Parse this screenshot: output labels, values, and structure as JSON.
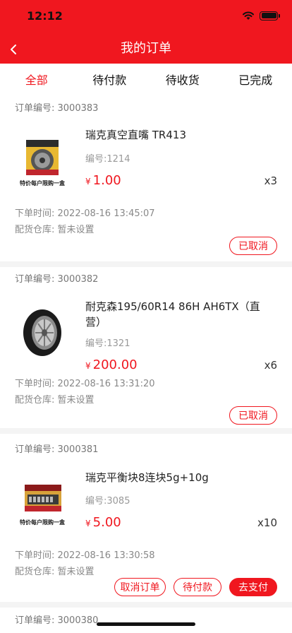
{
  "status_bar": {
    "time": "12:12"
  },
  "nav": {
    "title": "我的订单"
  },
  "tabs": [
    {
      "label": "全部",
      "active": true
    },
    {
      "label": "待付款",
      "active": false
    },
    {
      "label": "待收货",
      "active": false
    },
    {
      "label": "已完成",
      "active": false
    }
  ],
  "orders": [
    {
      "order_no": "订单编号: 3000383",
      "product_name": "瑞克真空直嘴 TR413",
      "product_code": "编号:1214",
      "image_caption": "特价每户限购一盒",
      "price_symbol": "¥",
      "price": "1.00",
      "quantity": "x3",
      "order_time": "下单时间: 2022-08-16 13:45:07",
      "warehouse": "配货仓库: 暂未设置",
      "buttons": [
        "已取消"
      ]
    },
    {
      "order_no": "订单编号: 3000382",
      "product_name": "耐克森195/60R14 86H AH6TX（直营）",
      "product_code": "编号:1321",
      "price_symbol": "¥",
      "price": "200.00",
      "quantity": "x6",
      "order_time": "下单时间: 2022-08-16 13:31:20",
      "warehouse": "配货仓库: 暂未设置",
      "buttons": [
        "已取消"
      ]
    },
    {
      "order_no": "订单编号: 3000381",
      "product_name": "瑞克平衡块8连块5g+10g",
      "product_code": "编号:3085",
      "image_caption": "特价每户限购一盒",
      "price_symbol": "¥",
      "price": "5.00",
      "quantity": "x10",
      "order_time": "下单时间: 2022-08-16 13:30:58",
      "warehouse": "配货仓库: 暂未设置",
      "buttons": [
        "取消订单",
        "待付款",
        "去支付"
      ]
    },
    {
      "order_no": "订单编号: 3000380"
    }
  ],
  "colors": {
    "brand": "#f0171f",
    "muted": "#888888",
    "separator": "#f4f4f4"
  }
}
